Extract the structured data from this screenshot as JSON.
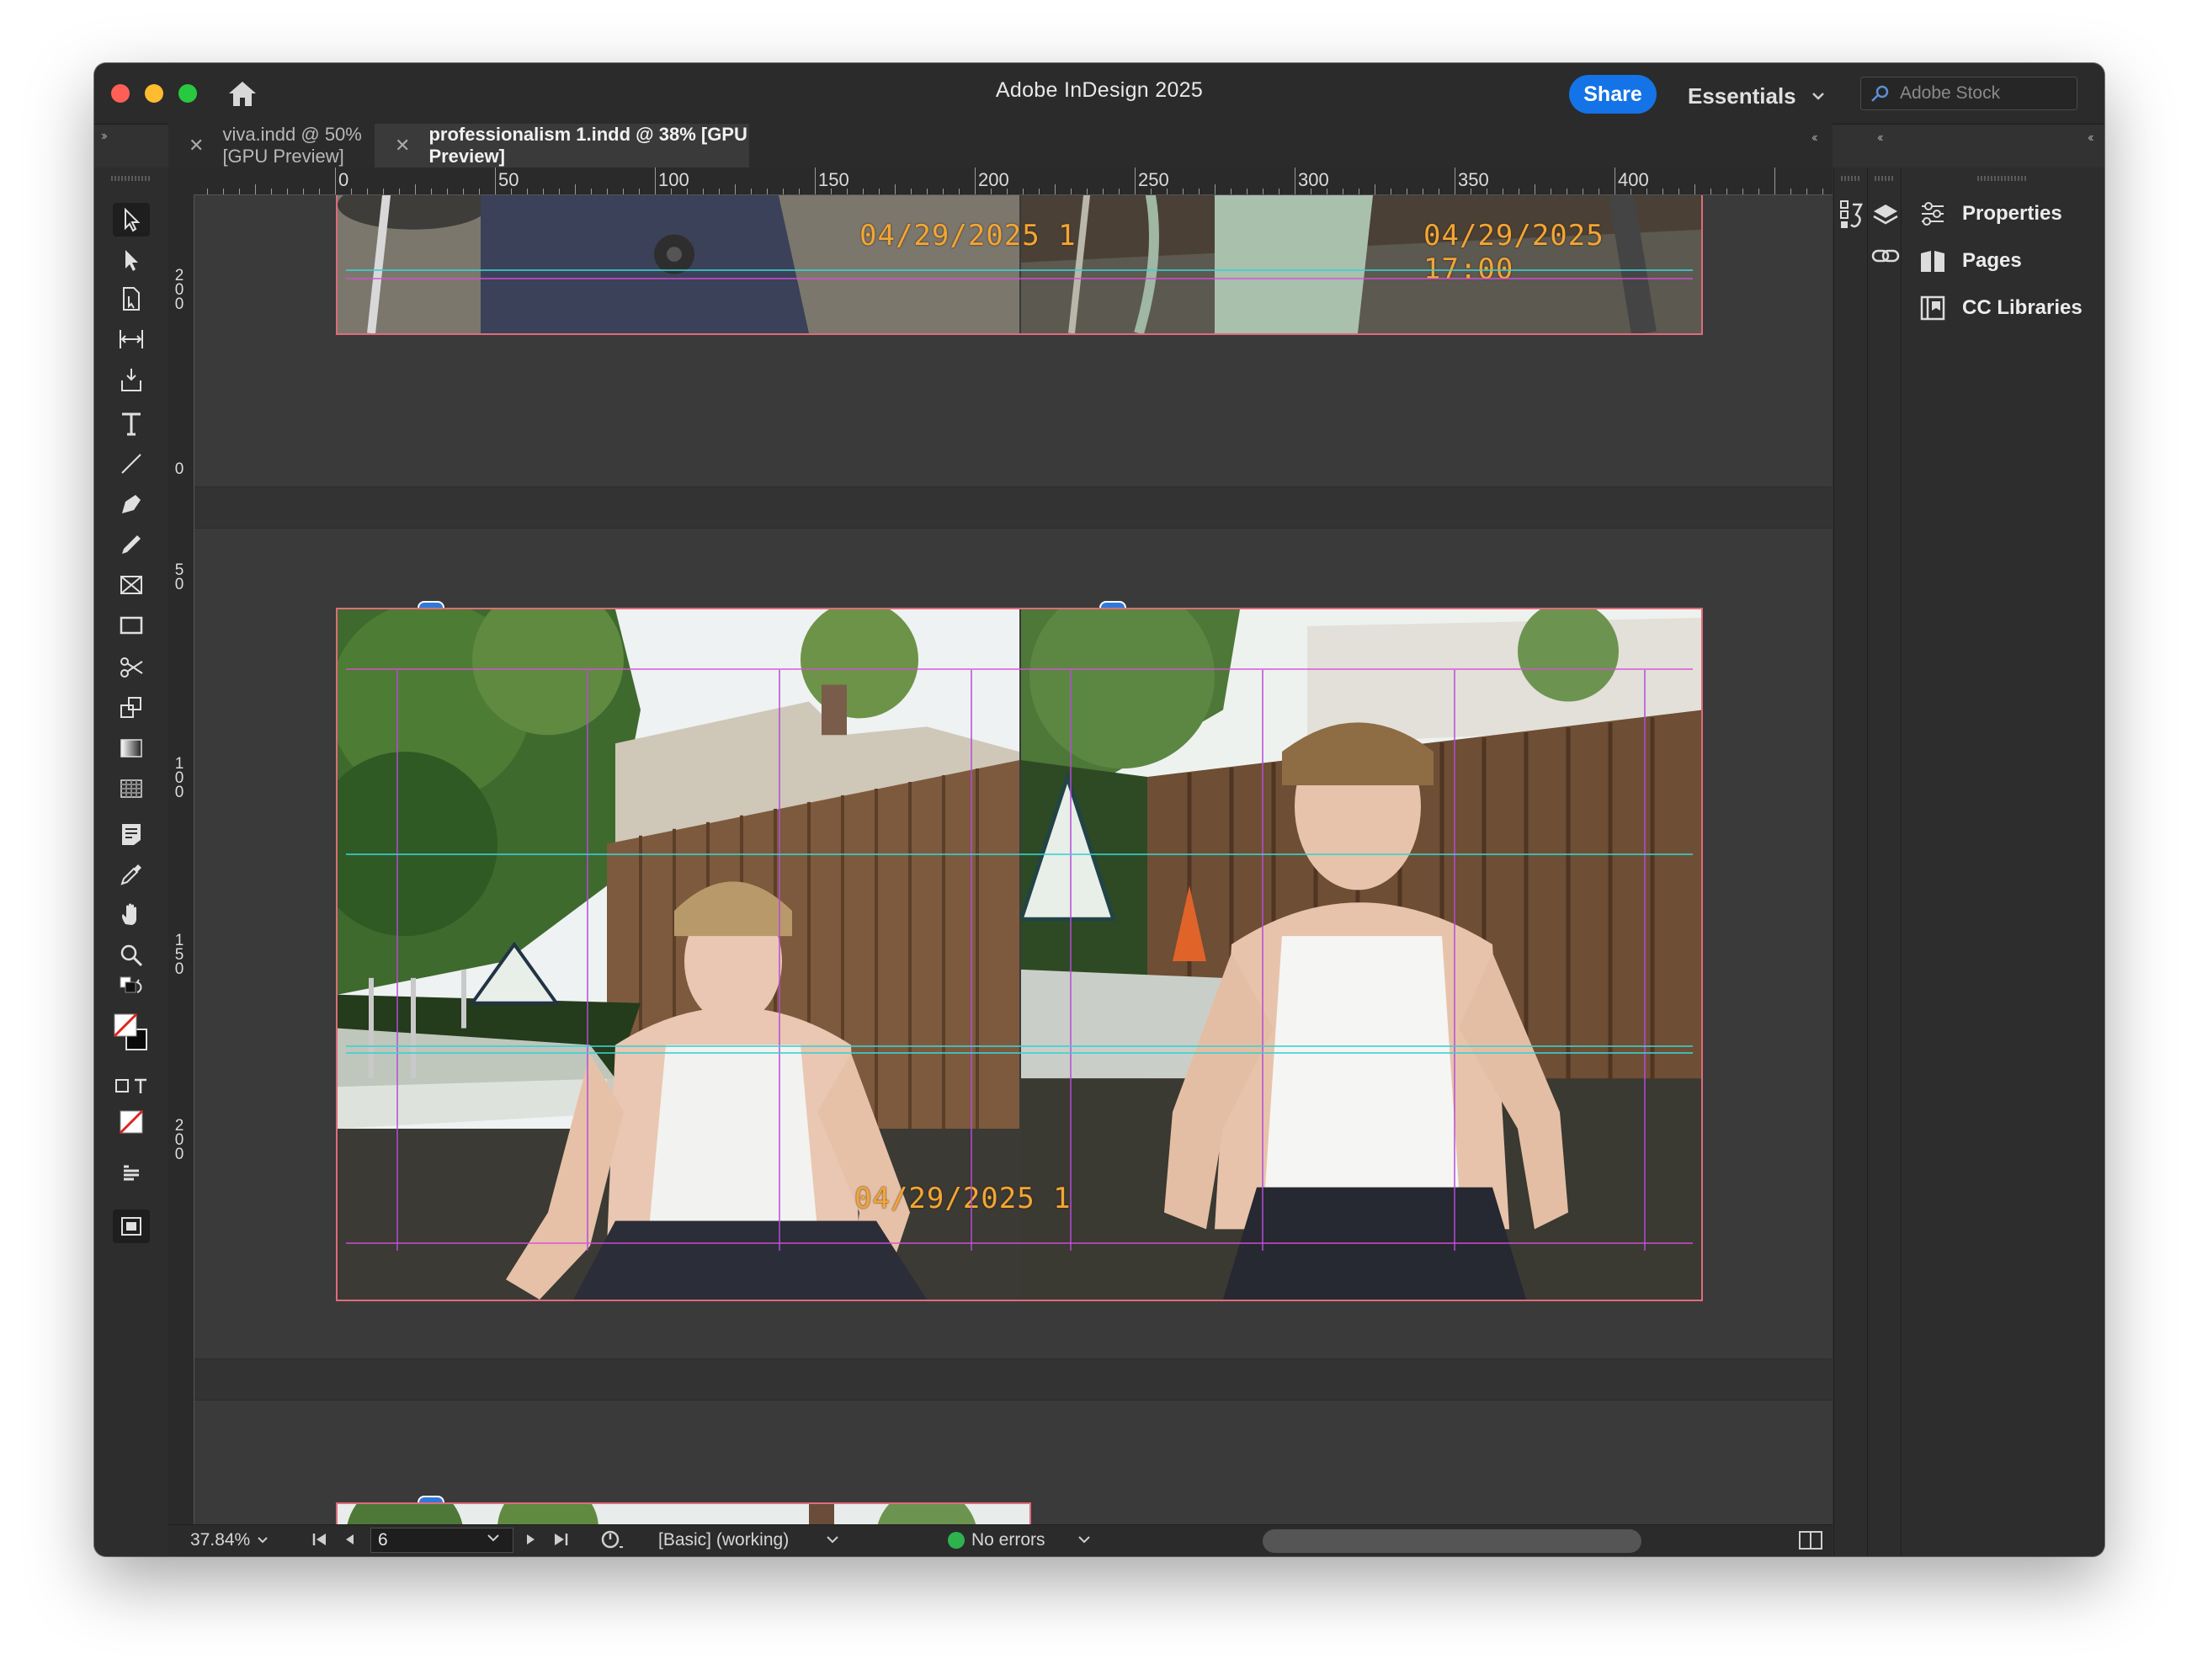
{
  "app": {
    "title": "Adobe InDesign 2025",
    "share_label": "Share",
    "workspace_label": "Essentials",
    "stock_search_placeholder": "Adobe Stock"
  },
  "tabs": [
    {
      "label": "viva.indd @ 50% [GPU Preview]",
      "active": false
    },
    {
      "label": "professionalism 1.indd @ 38% [GPU Preview]",
      "active": true
    }
  ],
  "ruler": {
    "horizontal_labels": [
      "0",
      "50",
      "100",
      "150",
      "200",
      "250",
      "300",
      "350",
      "400"
    ],
    "vertical_labels": [
      "2\n0\n0",
      "0",
      "5\n0",
      "1\n0\n0",
      "1\n5\n0",
      "2\n0\n0",
      "0"
    ]
  },
  "canvas": {
    "timestamps": [
      "04/29/2025 1",
      "04/29/2025 17:00",
      "04/29/2025 1"
    ]
  },
  "status": {
    "zoom": "37.84%",
    "page": "6",
    "preflight_profile": "[Basic] (working)",
    "errors": "No errors"
  },
  "panels": {
    "items": [
      {
        "label": "Properties",
        "icon": "properties-icon"
      },
      {
        "label": "Pages",
        "icon": "pages-icon"
      },
      {
        "label": "CC Libraries",
        "icon": "cc-libraries-icon"
      }
    ]
  },
  "colors": {
    "share_blue": "#1473e6",
    "timestamp_orange": "#f1a636",
    "bleed_red": "#e06b7a",
    "guide_cyan": "#3bd1d1",
    "column_purple": "#b44cd8",
    "status_green": "#2db24f"
  }
}
